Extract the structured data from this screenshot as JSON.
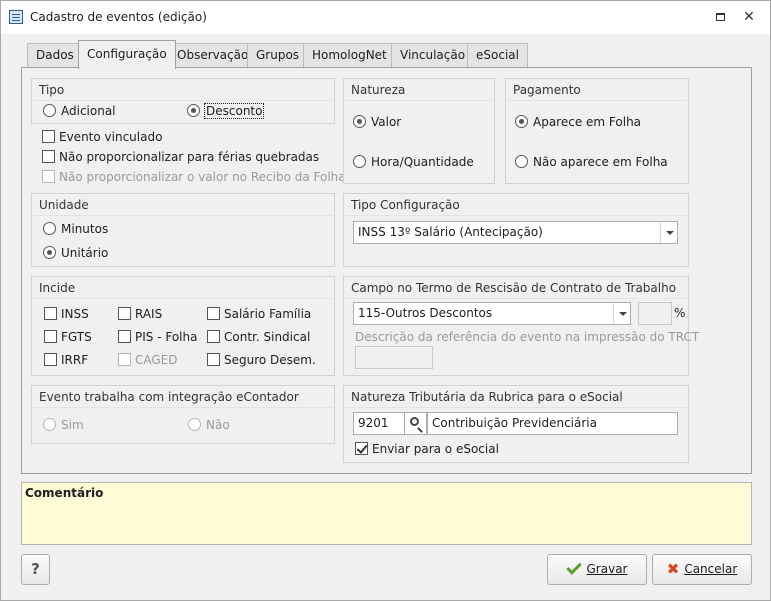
{
  "window": {
    "title": "Cadastro de eventos (edição)"
  },
  "tabs": [
    {
      "label": "Dados"
    },
    {
      "label": "Configuração"
    },
    {
      "label": "Observação"
    },
    {
      "label": "Grupos"
    },
    {
      "label": "HomologNet"
    },
    {
      "label": "Vinculação"
    },
    {
      "label": "eSocial"
    }
  ],
  "tipo": {
    "title": "Tipo",
    "adicional": "Adicional",
    "desconto": "Desconto",
    "selected": "desconto"
  },
  "checks": {
    "evento_vinculado": "Evento vinculado",
    "nao_prop_ferias": "Não proporcionalizar para férias quebradas",
    "nao_prop_recibo": "Não proporcionalizar o valor no Recibo da Folha"
  },
  "natureza": {
    "title": "Natureza",
    "valor": "Valor",
    "hora": "Hora/Quantidade",
    "selected": "valor"
  },
  "pagamento": {
    "title": "Pagamento",
    "aparece": "Aparece em Folha",
    "nao_aparece": "Não aparece em Folha",
    "selected": "aparece"
  },
  "unidade": {
    "title": "Unidade",
    "minutos": "Minutos",
    "unitario": "Unitário",
    "selected": "unitario"
  },
  "tipo_config": {
    "title": "Tipo Configuração",
    "value": "INSS 13º Salário (Antecipação)"
  },
  "incide": {
    "title": "Incide",
    "inss": "INSS",
    "rais": "RAIS",
    "salario_familia": "Salário Família",
    "fgts": "FGTS",
    "pis_folha": "PIS - Folha",
    "contr_sindical": "Contr. Sindical",
    "irrf": "IRRF",
    "caged": "CAGED",
    "seguro_desem": "Seguro Desem."
  },
  "rescisao": {
    "title": "Campo no Termo de Rescisão de Contrato de Trabalho",
    "value": "115-Outros Descontos",
    "percent": "%",
    "descricao_label": "Descrição da referência do evento na impressão do TRCT"
  },
  "econtador": {
    "title": "Evento trabalha com integração eContador",
    "sim": "Sim",
    "nao": "Não"
  },
  "esocial": {
    "title": "Natureza Tributária da Rubrica para o eSocial",
    "code": "9201",
    "description": "Contribuição Previdenciária",
    "enviar": "Enviar para o eSocial"
  },
  "comment": {
    "label": "Comentário"
  },
  "buttons": {
    "help": "?",
    "gravar": "Gravar",
    "cancelar": "Cancelar"
  },
  "colors": {
    "comment_bg": "#fdfcd7",
    "ok_green": "#5aa02c",
    "cancel_red": "#d8471c"
  }
}
